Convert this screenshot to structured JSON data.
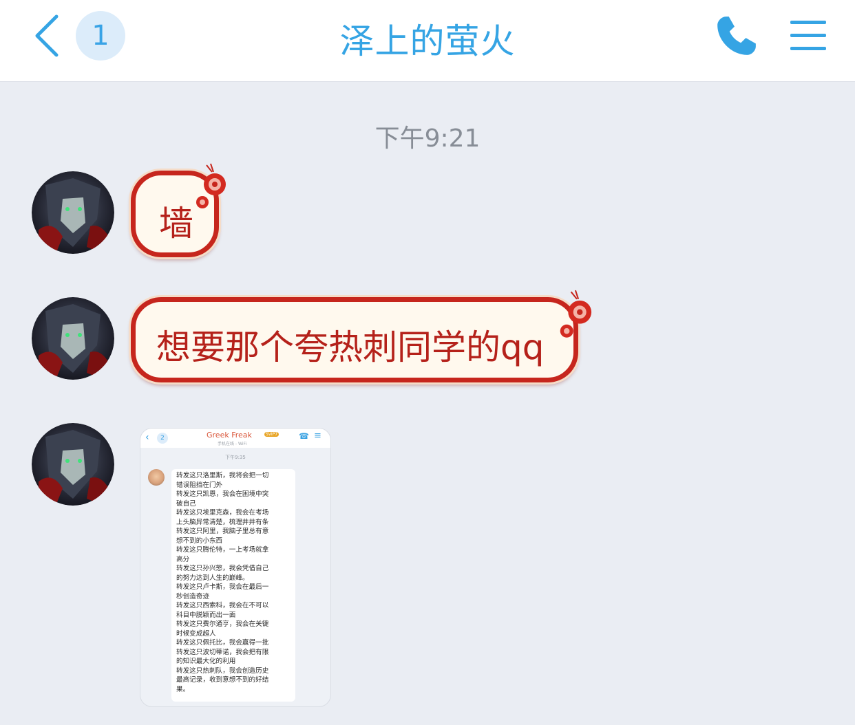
{
  "header": {
    "back_icon": "chevron-left-icon",
    "unread_count": "1",
    "title": "泽上的萤火",
    "call_icon": "phone-icon",
    "menu_icon": "menu-icon"
  },
  "colors": {
    "accent": "#35a4e4",
    "bubble_border": "#c6261d",
    "bubble_fill": "#fff9ee",
    "bubble_text": "#b5211a",
    "background": "#eaedf3"
  },
  "chat": {
    "timestamp": "下午9:21",
    "messages": [
      {
        "type": "text",
        "text": "墙"
      },
      {
        "type": "text",
        "text": "想要那个夸热刺同学的qq"
      },
      {
        "type": "image",
        "screenshot": {
          "unread": "2",
          "title": "Greek Freak",
          "vip": "SVIP7",
          "subtitle": "手机在线 - WiFi",
          "time": "下午9:35",
          "lines": [
            "转发这只洛里斯，我将会把一切",
            "错误阻挡在门外",
            "转发这只凯恩，我会在困境中突",
            "破自己",
            "转发这只埃里克森，我会在考场",
            "上头脑异常清楚，梳理井井有条",
            "转发这只阿里，我脑子里总有意",
            "想不到的小东西",
            "转发这只腾伦特，一上考场就拿",
            "高分",
            "转发这只孙兴慜，我会凭借自己",
            "的努力达到人生的巅峰。",
            "转发这只卢卡斯，我会在最后一",
            "秒创造奇迹",
            "转发这只西索科，我会在不可以",
            "科目中脱颖而出一面",
            "转发这只费尔通亨，我会在关键",
            "时候变成超人",
            "转发这只佩托比，我会赢得一批",
            "转发这只波切蒂诺，我会把有限",
            "的知识最大化的利用",
            "转发这只热刺队，我会创造历史",
            "最高记录，收到意想不到的好结",
            "果。"
          ]
        }
      }
    ]
  }
}
